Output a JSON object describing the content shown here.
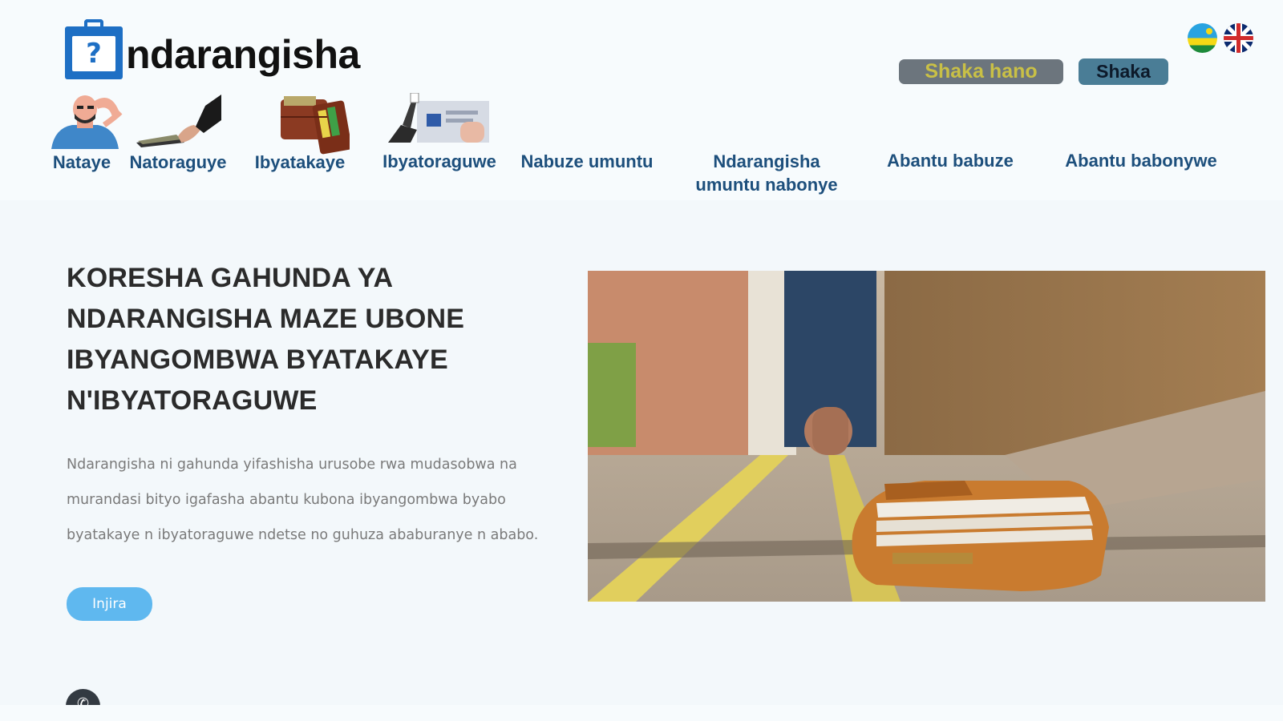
{
  "header": {
    "logo_mark": "?",
    "logo_text": "ndarangisha",
    "search_here_label": "Shaka hano",
    "search_label": "Shaka",
    "languages": [
      {
        "name": "rwanda-flag"
      },
      {
        "name": "uk-flag"
      }
    ]
  },
  "nav": {
    "items": [
      {
        "label": "Nataye",
        "icon": "confused-person-icon"
      },
      {
        "label": "Natoraguye",
        "icon": "hand-wallet-icon"
      },
      {
        "label": "Ibyatakaye",
        "icon": "wallet-icon"
      },
      {
        "label": "Ibyatoraguwe",
        "icon": "id-card-icon"
      },
      {
        "label": "Nabuze umuntu"
      },
      {
        "label_line1": "Ndarangisha",
        "label_line2": "umuntu nabonye"
      },
      {
        "label": "Abantu babuze"
      },
      {
        "label": "Abantu babonywe"
      }
    ]
  },
  "hero": {
    "title_lines": [
      "KORESHA GAHUNDA YA",
      "NDARANGISHA MAZE UBONE",
      "IBYANGOMBWA BYATAKAYE",
      "N'IBYATORAGUWE"
    ],
    "text_lines": [
      "Ndarangisha ni gahunda yifashisha urusobe rwa mudasobwa na",
      "murandasi bityo igafasha abantu kubona ibyangombwa byabo",
      "byatakaye n ibyatoraguwe ndetse no guhuza ababuranye n ababo."
    ],
    "button_label": "Injira",
    "image": "lost-wallet-on-street-photo"
  },
  "colors": {
    "nav_text": "#1d4f7c",
    "search_here_bg": "#6c757d",
    "search_here_text": "#c9c046",
    "search_bg": "#4a7d96",
    "enter_button": "#5fb8ef"
  }
}
